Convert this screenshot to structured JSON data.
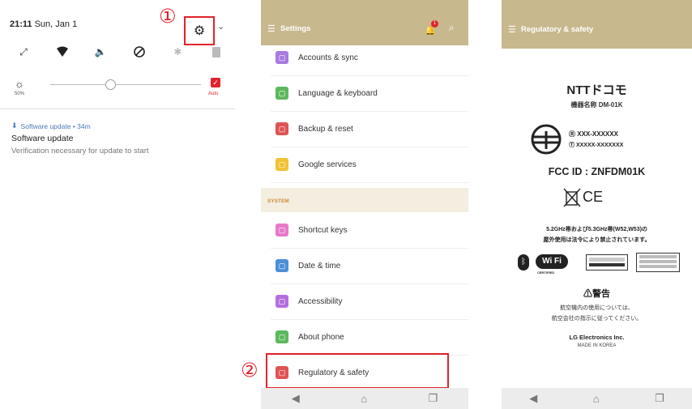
{
  "panel1": {
    "time": "21:11",
    "date": "Sun, Jan 1",
    "step_marker": "①",
    "brightness_percent": "50%",
    "auto_label": "Auto",
    "brightness_level": 0.4,
    "notification": {
      "app_line": "Software update • 34m",
      "title": "Software update",
      "text": "Verification necessary for update to start"
    }
  },
  "panel2": {
    "title": "Settings",
    "badge": "1",
    "section_label": "SYSTEM",
    "items_top": [
      {
        "label": "Accounts & sync",
        "color": "#a77be0",
        "icon": "sync-icon"
      },
      {
        "label": "Language & keyboard",
        "color": "#5cb85c",
        "icon": "keyboard-icon"
      },
      {
        "label": "Backup & reset",
        "color": "#e05353",
        "icon": "backup-icon"
      },
      {
        "label": "Google services",
        "color": "#f1c232",
        "icon": "google-icon"
      }
    ],
    "items_system": [
      {
        "label": "Shortcut keys",
        "color": "#e879c9",
        "icon": "shortcut-icon"
      },
      {
        "label": "Date & time",
        "color": "#4a90d9",
        "icon": "clock-icon"
      },
      {
        "label": "Accessibility",
        "color": "#b36fe0",
        "icon": "accessibility-icon"
      },
      {
        "label": "About phone",
        "color": "#5cb85c",
        "icon": "info-icon"
      },
      {
        "label": "Regulatory & safety",
        "color": "#e05353",
        "icon": "regulatory-icon"
      }
    ],
    "step_marker": "②"
  },
  "panel3": {
    "title": "Regulatory & safety",
    "carrier": "NTTドコモ",
    "model_line": "機器名称 DM-01K",
    "cert_line1": "XXX-XXXXXX",
    "cert_line2": "XXXXX-XXXXXXX",
    "fcc": "FCC ID : ZNFDM01K",
    "ce": "CE",
    "notice1": "5.2GHz帯および5.3GHz帯(W52,W53)の",
    "notice2": "屋外使用は法令により禁止されています。",
    "wifi_cert": "CERTIFIED",
    "warning_title": "警告",
    "warning1": "航空機内の使用については、",
    "warning2": "航空会社の指示に従ってください。",
    "maker": "LG Electronics Inc.",
    "origin": "MADE IN KOREA"
  },
  "colors": {
    "accent": "#e0232c",
    "appbar": "#c8b88e",
    "section": "#f3eedf"
  }
}
